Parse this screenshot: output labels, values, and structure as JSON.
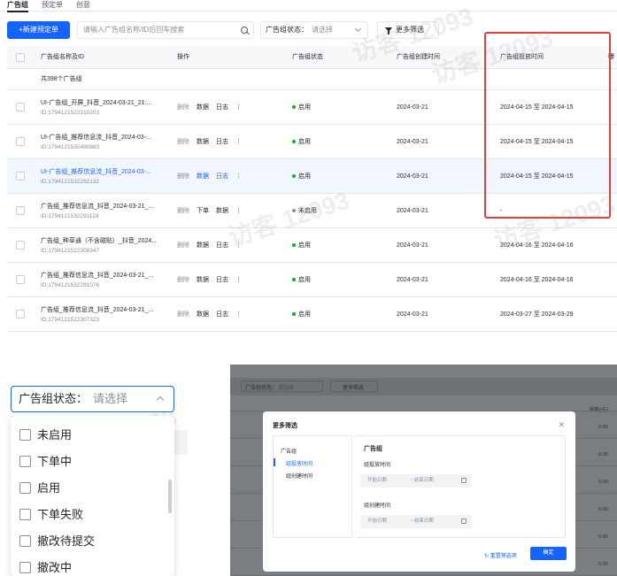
{
  "tabs": [
    "广告组",
    "预定单",
    "创意"
  ],
  "toolbar": {
    "new_button": "+新建预定单",
    "search_placeholder": "请输入广告组名称/ID后回车搜索",
    "status_label": "广告组状态：",
    "status_placeholder": "请选择",
    "more_filter": "更多筛选"
  },
  "table": {
    "headers": [
      "广告组名称及ID",
      "操作",
      "广告组状态",
      "广告组创建时间",
      "广告组投放时间",
      "曝"
    ],
    "count_text": "共398个广告组",
    "rows": [
      {
        "name": "UI-广告组_开屏_抖音_2024-03-21_21:...",
        "id": "ID:1794121522310203",
        "ops": [
          "删除",
          "数据",
          "日志",
          "⋮"
        ],
        "status": "启用",
        "status_color": "#00b42a",
        "created": "2024-03-21",
        "schedule": "2024-04-15 至 2024-04-15"
      },
      {
        "name": "UI-广告组_推荐信息流_抖音_2024-03-...",
        "id": "ID:1794121530490883",
        "ops": [
          "删除",
          "数据",
          "日志",
          "⋮"
        ],
        "status": "启用",
        "status_color": "#00b42a",
        "created": "2024-03-21",
        "schedule": "2024-04-15 至 2024-04-15"
      },
      {
        "name": "UI-广告组_推荐信息流_抖音_2024-03-...",
        "id": "ID:1794121532292132",
        "ops": [
          "删除",
          "数据",
          "日志",
          "⋮"
        ],
        "status": "启用",
        "status_color": "#00b42a",
        "created": "2024-03-21",
        "schedule": "2024-04-15 至 2024-04-15"
      },
      {
        "name": "广告组_推荐信息流_抖音_2024-03-21_...",
        "id": "ID:1794121532291124",
        "ops": [
          "删除",
          "下单",
          "数据",
          "⋮"
        ],
        "status": "未启用",
        "status_color": "#86909c",
        "created": "2024-03-21",
        "schedule": "-"
      },
      {
        "name": "广告组_种草通（不含磁贴）_抖音_2024...",
        "id": "ID:1794121522308347",
        "ops": [
          "删除",
          "数据",
          "日志",
          "⋮"
        ],
        "status": "启用",
        "status_color": "#00b42a",
        "created": "2024-03-21",
        "schedule": "2024-04-16 至 2024-04-16"
      },
      {
        "name": "广告组_推荐信息流_抖音_2024-03-21_...",
        "id": "ID:1794121532291076",
        "ops": [
          "删除",
          "数据",
          "日志",
          "⋮"
        ],
        "status": "启用",
        "status_color": "#00b42a",
        "created": "2024-03-21",
        "schedule": "2024-04-16 至 2024-04-16"
      },
      {
        "name": "广告组_推荐信息流_抖音_2024-03-21_...",
        "id": "ID:1794121522307323",
        "ops": [
          "删除",
          "数据",
          "日志",
          "⋮"
        ],
        "status": "启用",
        "status_color": "#00b42a",
        "created": "2024-03-21",
        "schedule": "2024-03-27 至 2024-03-29"
      }
    ]
  },
  "watermark": "访客 12093",
  "dropdown": {
    "label": "广告组状态：",
    "placeholder": "请选择",
    "options": [
      "未启用",
      "下单中",
      "启用",
      "下单失败",
      "撤改待提交",
      "撤改中"
    ]
  },
  "modal": {
    "bg_status_label": "广告组状态：",
    "bg_status_placeholder": "请选择",
    "bg_more_filter": "更多筛选",
    "bg_values": [
      "0.00",
      "0.00",
      "0.00",
      "0.00",
      "0.00",
      "0.00",
      "0.00"
    ],
    "bg_exposure": "消耗(元)",
    "title": "更多筛选",
    "side_group": "广告组",
    "side_items": [
      "组投放时间",
      "组创建时间"
    ],
    "section": "广告组",
    "field1": "组投放时间",
    "field2": "组创建时间",
    "start_placeholder": "开始日期",
    "end_placeholder": "~ 结束日期",
    "reset": "重置筛选项",
    "ok": "确定"
  }
}
